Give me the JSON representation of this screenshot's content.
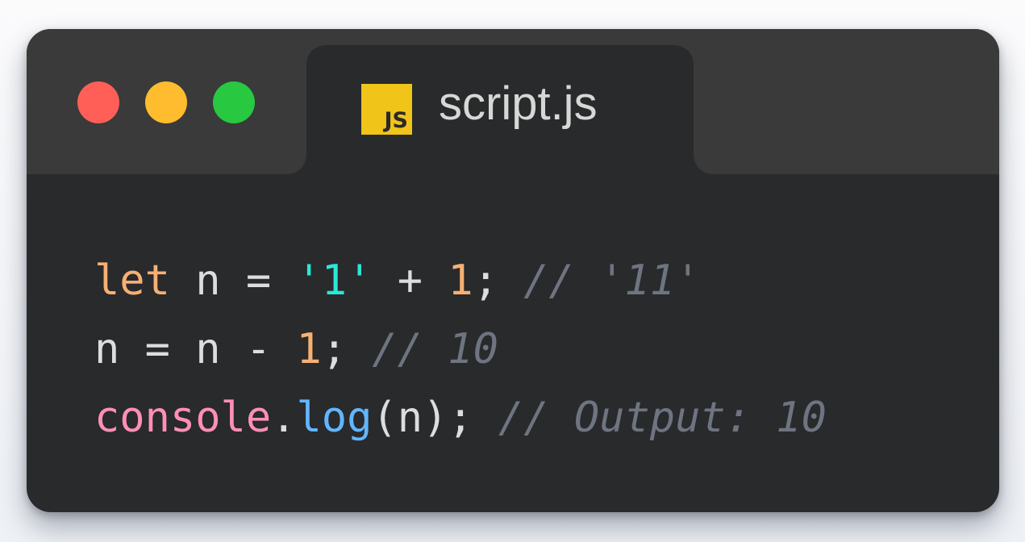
{
  "window": {
    "colors": {
      "titlebar": "#393a39",
      "editor_background": "#282a2c",
      "close": "#ff5f57",
      "minimize": "#febc2e",
      "maximize": "#28c840"
    }
  },
  "tab": {
    "badge_text": "JS",
    "badge_color": "#f0c419",
    "title": "script.js"
  },
  "code": {
    "lines": [
      {
        "tokens": [
          {
            "type": "kw",
            "text": "let"
          },
          {
            "type": "plain",
            "text": " n = "
          },
          {
            "type": "str",
            "text": "'1'"
          },
          {
            "type": "plain",
            "text": " + "
          },
          {
            "type": "num",
            "text": "1"
          },
          {
            "type": "plain",
            "text": "; "
          },
          {
            "type": "comment",
            "text": "// '11'"
          }
        ]
      },
      {
        "tokens": [
          {
            "type": "plain",
            "text": "n = n - "
          },
          {
            "type": "num",
            "text": "1"
          },
          {
            "type": "plain",
            "text": "; "
          },
          {
            "type": "comment",
            "text": "// 10"
          }
        ]
      },
      {
        "tokens": [
          {
            "type": "obj",
            "text": "console"
          },
          {
            "type": "plain",
            "text": "."
          },
          {
            "type": "fn",
            "text": "log"
          },
          {
            "type": "plain",
            "text": "(n); "
          },
          {
            "type": "comment",
            "text": "// Output: 10"
          }
        ]
      }
    ]
  }
}
